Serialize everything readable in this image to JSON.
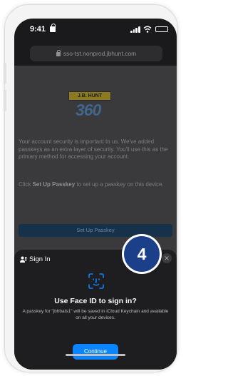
{
  "status_bar": {
    "time": "9:41"
  },
  "browser": {
    "url": "sso-tst.nonprod.jbhunt.com"
  },
  "page": {
    "logo_text": "J.B. HUNT",
    "logo_360": "360",
    "security_text": "Your account security is important to us. We've added passkeys as an extra layer of security. You'll use this as the primary method for accessing your account.",
    "instruction_prefix": "Click ",
    "instruction_bold": "Set Up Passkey",
    "instruction_suffix": " to set up a passkey on this device.",
    "setup_button_label": "Set Up Passkey"
  },
  "sheet": {
    "header": "Sign In",
    "title": "Use Face ID to sign in?",
    "description": "A passkey for \"jbhbats1\" will be saved in iCloud Keychain and available on all your devices.",
    "continue_label": "Continue",
    "close_glyph": "✕"
  },
  "annotation": {
    "step": "4"
  },
  "colors": {
    "accent": "#0a84ff",
    "badge": "#1c3f8a",
    "brand_blue": "#40668e"
  }
}
